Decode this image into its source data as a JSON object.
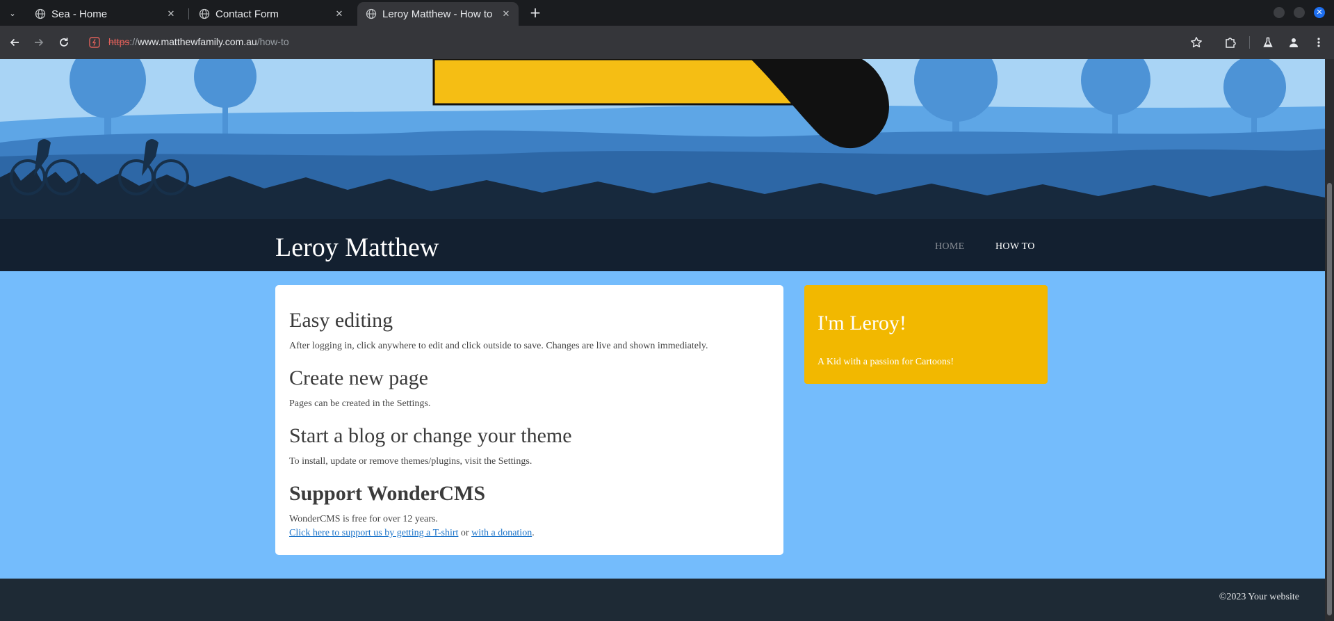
{
  "browser": {
    "tabs": [
      {
        "title": "Sea - Home"
      },
      {
        "title": "Contact Form"
      },
      {
        "title": "Leroy Matthew - How to"
      }
    ],
    "url": {
      "scheme": "https",
      "sep": "://",
      "host": "www.matthewfamily.com.au",
      "path": "/how-to"
    }
  },
  "site": {
    "title": "Leroy Matthew",
    "nav": [
      {
        "label": "HOME",
        "active": false
      },
      {
        "label": "HOW TO",
        "active": true
      }
    ]
  },
  "content": {
    "sections": [
      {
        "heading": "Easy editing",
        "text": "After logging in, click anywhere to edit and click outside to save. Changes are live and shown immediately."
      },
      {
        "heading": "Create new page",
        "text": "Pages can be created in the Settings."
      },
      {
        "heading": "Start a blog or change your theme",
        "text": "To install, update or remove themes/plugins, visit the Settings."
      },
      {
        "heading": "Support WonderCMS",
        "text": "WonderCMS is free for over 12 years."
      }
    ],
    "support_line": {
      "link1": "Click here to support us by getting a T-shirt",
      "mid": " or ",
      "link2": "with a donation",
      "end": "."
    }
  },
  "aside": {
    "heading": "I'm Leroy!",
    "text": "A Kid with a passion for Cartoons!"
  },
  "footer": {
    "text": "©2023 Your website"
  },
  "colors": {
    "page_background": "#74bcfc",
    "header_background": "#132030",
    "aside_background": "#f2b800",
    "footer_background": "#1e2a35",
    "link": "#1a73c9"
  }
}
